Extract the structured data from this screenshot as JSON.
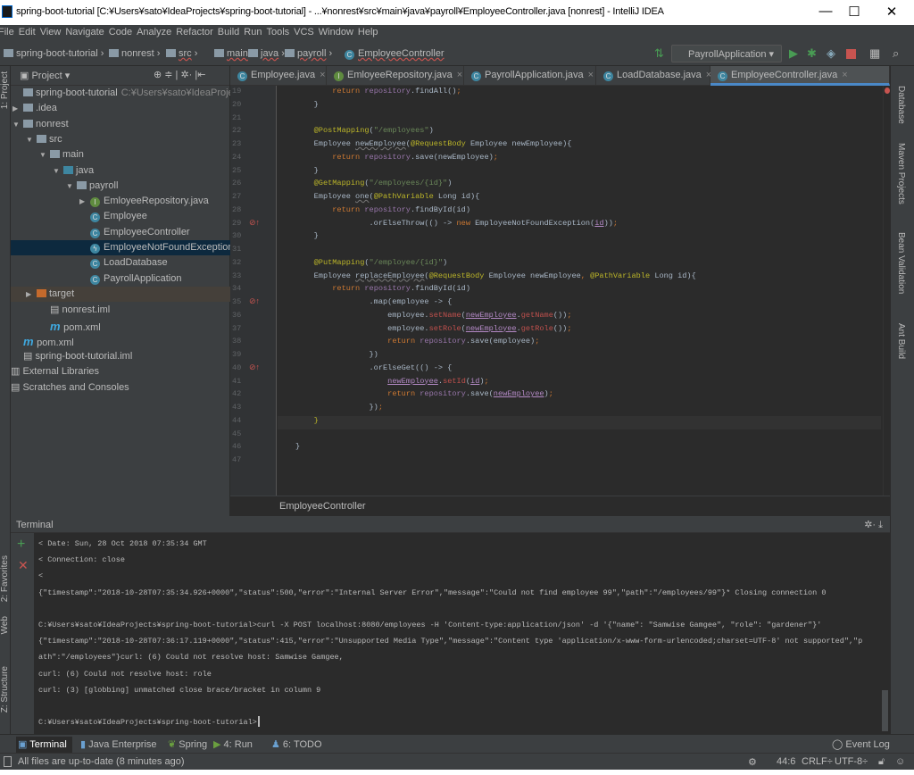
{
  "window": {
    "title": "spring-boot-tutorial [C:¥Users¥sato¥IdeaProjects¥spring-boot-tutorial] - ...¥nonrest¥src¥main¥java¥payroll¥EmployeeController.java [nonrest] - IntelliJ IDEA",
    "minimize": "—",
    "maximize": "☐",
    "close": "✕"
  },
  "menu": [
    "File",
    "Edit",
    "View",
    "Navigate",
    "Code",
    "Analyze",
    "Refactor",
    "Build",
    "Run",
    "Tools",
    "VCS",
    "Window",
    "Help"
  ],
  "breadcrumb": [
    "spring-boot-tutorial",
    "nonrest",
    "src",
    "main",
    "java",
    "payroll",
    "EmployeeController"
  ],
  "toolbar": {
    "run_config": "PayrollApplication",
    "colors": {
      "run": "#499c54",
      "stop": "#c75450",
      "accent": "#4a88c7"
    }
  },
  "left_stripe": [
    "1: Project",
    "2: Favorites",
    "Web",
    "Z: Structure"
  ],
  "right_stripe": [
    "Database",
    "Maven Projects",
    "Bean Validation",
    "Ant Build"
  ],
  "project": {
    "title": "Project",
    "tree": [
      {
        "label": "spring-boot-tutorial",
        "suffix": "C:¥Users¥sato¥IdeaProjects¥sp",
        "depth": 0,
        "icon": "module-folder",
        "arrow": ""
      },
      {
        "label": ".idea",
        "depth": 0,
        "icon": "folder",
        "arrow": "▶"
      },
      {
        "label": "nonrest",
        "depth": 0,
        "icon": "module-folder",
        "arrow": "▼"
      },
      {
        "label": "src",
        "depth": 1,
        "icon": "folder",
        "arrow": "▼"
      },
      {
        "label": "main",
        "depth": 2,
        "icon": "folder",
        "arrow": "▼"
      },
      {
        "label": "java",
        "depth": 3,
        "icon": "source-folder",
        "arrow": "▼"
      },
      {
        "label": "payroll",
        "depth": 4,
        "icon": "package",
        "arrow": "▼"
      },
      {
        "label": "EmloyeeRepository.java",
        "depth": 5,
        "icon": "interface",
        "arrow": "▶"
      },
      {
        "label": "Employee",
        "depth": 5,
        "icon": "class",
        "arrow": ""
      },
      {
        "label": "EmployeeController",
        "depth": 5,
        "icon": "class",
        "arrow": ""
      },
      {
        "label": "EmployeeNotFoundException",
        "depth": 5,
        "icon": "exception",
        "arrow": "",
        "selected": true
      },
      {
        "label": "LoadDatabase",
        "depth": 5,
        "icon": "class",
        "arrow": ""
      },
      {
        "label": "PayrollApplication",
        "depth": 5,
        "icon": "spring-boot-class",
        "arrow": ""
      },
      {
        "label": "target",
        "depth": 1,
        "icon": "excluded-folder",
        "arrow": "▶",
        "target": true
      },
      {
        "label": "nonrest.iml",
        "depth": 2,
        "icon": "iml-file",
        "arrow": ""
      },
      {
        "label": "pom.xml",
        "depth": 2,
        "icon": "maven",
        "arrow": ""
      },
      {
        "label": "pom.xml",
        "depth": 0,
        "icon": "maven",
        "arrow": ""
      },
      {
        "label": "spring-boot-tutorial.iml",
        "depth": 0,
        "icon": "iml-file",
        "arrow": ""
      },
      {
        "label": "External Libraries",
        "depth": -1,
        "icon": "libraries",
        "arrow": ""
      },
      {
        "label": "Scratches and Consoles",
        "depth": -1,
        "icon": "scratches",
        "arrow": ""
      }
    ]
  },
  "tabs": [
    {
      "label": "Employee.java",
      "icon": "class"
    },
    {
      "label": "EmloyeeRepository.java",
      "icon": "interface"
    },
    {
      "label": "PayrollApplication.java",
      "icon": "spring-boot-class"
    },
    {
      "label": "LoadDatabase.java",
      "icon": "class"
    },
    {
      "label": "EmployeeController.java",
      "icon": "class",
      "active": true
    }
  ],
  "code": [
    {
      "n": "19",
      "t": [
        [
          "        ",
          ""
        ],
        [
          "return ",
          "kw"
        ],
        [
          "repository",
          "fld"
        ],
        [
          ".findAll()",
          ""
        ],
        [
          ";",
          "kw"
        ]
      ]
    },
    {
      "n": "20",
      "t": [
        [
          "    }",
          ""
        ]
      ]
    },
    {
      "n": "21",
      "t": []
    },
    {
      "n": "22",
      "t": [
        [
          "    @PostMapping",
          "an"
        ],
        [
          "(",
          ""
        ],
        [
          "\"/employees\"",
          "st"
        ],
        [
          ")",
          ""
        ]
      ]
    },
    {
      "n": "23",
      "t": [
        [
          "    Employee ",
          ""
        ],
        [
          "newEmployee",
          "wv"
        ],
        [
          "(",
          ""
        ],
        [
          "@RequestBody",
          "an"
        ],
        [
          " Employee newEmployee){",
          ""
        ]
      ]
    },
    {
      "n": "24",
      "t": [
        [
          "        ",
          ""
        ],
        [
          "return ",
          "kw"
        ],
        [
          "repository",
          "fld"
        ],
        [
          ".save(newEmployee)",
          ""
        ],
        [
          ";",
          "kw"
        ]
      ]
    },
    {
      "n": "25",
      "t": [
        [
          "    }",
          ""
        ]
      ]
    },
    {
      "n": "26",
      "t": [
        [
          "    @GetMapping",
          "an"
        ],
        [
          "(",
          ""
        ],
        [
          "\"/employees/{id}\"",
          "st"
        ],
        [
          ")",
          ""
        ]
      ]
    },
    {
      "n": "27",
      "t": [
        [
          "    Employee ",
          ""
        ],
        [
          "one",
          "wv"
        ],
        [
          "(",
          ""
        ],
        [
          "@PathVariable",
          "an"
        ],
        [
          " Long id){",
          ""
        ]
      ]
    },
    {
      "n": "28",
      "t": [
        [
          "        ",
          ""
        ],
        [
          "return ",
          "kw"
        ],
        [
          "repository",
          "fld"
        ],
        [
          ".findById(id)",
          ""
        ]
      ]
    },
    {
      "n": "29",
      "t": [
        [
          "                .orElseThrow(() -> ",
          ""
        ],
        [
          "new ",
          "kw"
        ],
        [
          "EmployeeNotFoundException(",
          ""
        ],
        [
          "id",
          "ul"
        ],
        [
          "))",
          ""
        ],
        [
          ";",
          "kw"
        ]
      ],
      "bp": true
    },
    {
      "n": "30",
      "t": [
        [
          "    }",
          ""
        ]
      ]
    },
    {
      "n": "31",
      "t": []
    },
    {
      "n": "32",
      "t": [
        [
          "    @PutMapping",
          "an"
        ],
        [
          "(",
          ""
        ],
        [
          "\"/employee/{id}\"",
          "st"
        ],
        [
          ")",
          ""
        ]
      ]
    },
    {
      "n": "33",
      "t": [
        [
          "    Employee ",
          ""
        ],
        [
          "replaceEmployee",
          "wv"
        ],
        [
          "(",
          ""
        ],
        [
          "@RequestBody",
          "an"
        ],
        [
          " Employee newEmployee",
          ""
        ],
        [
          ", ",
          "kw"
        ],
        [
          "@PathVariable",
          "an"
        ],
        [
          " Long id){",
          ""
        ]
      ]
    },
    {
      "n": "34",
      "t": [
        [
          "        ",
          ""
        ],
        [
          "return ",
          "kw"
        ],
        [
          "repository",
          "fld"
        ],
        [
          ".findById(id)",
          ""
        ]
      ]
    },
    {
      "n": "35",
      "t": [
        [
          "                .map(employee -> {",
          ""
        ]
      ],
      "bp": true
    },
    {
      "n": "36",
      "t": [
        [
          "                    employee.",
          ""
        ],
        [
          "setName",
          "mt"
        ],
        [
          "(",
          ""
        ],
        [
          "newEmployee",
          "ul"
        ],
        [
          ".",
          ""
        ],
        [
          "getName",
          "mt"
        ],
        [
          "())",
          ""
        ],
        [
          ";",
          "kw"
        ]
      ]
    },
    {
      "n": "37",
      "t": [
        [
          "                    employee.",
          ""
        ],
        [
          "setRole",
          "mt"
        ],
        [
          "(",
          ""
        ],
        [
          "newEmployee",
          "ul"
        ],
        [
          ".",
          ""
        ],
        [
          "getRole",
          "mt"
        ],
        [
          "())",
          ""
        ],
        [
          ";",
          "kw"
        ]
      ]
    },
    {
      "n": "38",
      "t": [
        [
          "                    ",
          ""
        ],
        [
          "return ",
          "kw"
        ],
        [
          "repository",
          "fld"
        ],
        [
          ".save(employee)",
          ""
        ],
        [
          ";",
          "kw"
        ]
      ]
    },
    {
      "n": "39",
      "t": [
        [
          "                })",
          ""
        ]
      ]
    },
    {
      "n": "40",
      "t": [
        [
          "                .orElseGet(() -> {",
          ""
        ]
      ],
      "bp": true
    },
    {
      "n": "41",
      "t": [
        [
          "                    ",
          ""
        ],
        [
          "newEmployee",
          "ul"
        ],
        [
          ".",
          ""
        ],
        [
          "setId",
          "mt"
        ],
        [
          "(",
          ""
        ],
        [
          "id",
          "ul"
        ],
        [
          ")",
          ""
        ],
        [
          ";",
          "kw"
        ]
      ]
    },
    {
      "n": "42",
      "t": [
        [
          "                    ",
          ""
        ],
        [
          "return ",
          "kw"
        ],
        [
          "repository",
          "fld"
        ],
        [
          ".save(",
          ""
        ],
        [
          "newEmployee",
          "ul"
        ],
        [
          ")",
          ""
        ],
        [
          ";",
          "kw"
        ]
      ]
    },
    {
      "n": "43",
      "t": [
        [
          "                })",
          ""
        ],
        [
          ";",
          "kw"
        ]
      ]
    },
    {
      "n": "44",
      "t": [
        [
          "    }",
          "an"
        ]
      ],
      "current": true
    },
    {
      "n": "45",
      "t": []
    },
    {
      "n": "46",
      "t": [
        [
          "}",
          ""
        ]
      ]
    },
    {
      "n": "47",
      "t": []
    }
  ],
  "editor_breadcrumb": "EmployeeController",
  "terminal": {
    "title": "Terminal",
    "lines": [
      "< Date: Sun, 28 Oct 2018 07:35:34 GMT",
      "< Connection: close",
      "<",
      "{\"timestamp\":\"2018-10-28T07:35:34.926+0000\",\"status\":500,\"error\":\"Internal Server Error\",\"message\":\"Could not find employee 99\",\"path\":\"/employees/99\"}* Closing connection 0",
      "",
      "C:¥Users¥sato¥IdeaProjects¥spring-boot-tutorial>curl -X POST localhost:8080/employees -H 'Content-type:application/json' -d '{\"name\": \"Samwise Gamgee\", \"role\": \"gardener\"}'",
      "{\"timestamp\":\"2018-10-28T07:36:17.119+0000\",\"status\":415,\"error\":\"Unsupported Media Type\",\"message\":\"Content type 'application/x-www-form-urlencoded;charset=UTF-8' not supported\",\"p",
      "ath\":\"/employees\"}curl: (6) Could not resolve host: Samwise Gamgee,",
      "curl: (6) Could not resolve host: role",
      "curl: (3) [globbing] unmatched close brace/bracket in column 9",
      "",
      "C:¥Users¥sato¥IdeaProjects¥spring-boot-tutorial>"
    ]
  },
  "tool_tabs": [
    {
      "label": "Terminal",
      "icon": "terminal-icon",
      "active": true
    },
    {
      "label": "Java Enterprise",
      "icon": "java-enterprise-icon"
    },
    {
      "label": "Spring",
      "icon": "spring-icon"
    },
    {
      "label": "4: Run",
      "icon": "run-icon"
    },
    {
      "label": "6: TODO",
      "icon": "todo-icon"
    }
  ],
  "event_log": "Event Log",
  "status": {
    "message": "All files are up-to-date (8 minutes ago)",
    "position": "44:6",
    "line_sep": "CRLF÷",
    "encoding": "UTF-8÷"
  }
}
